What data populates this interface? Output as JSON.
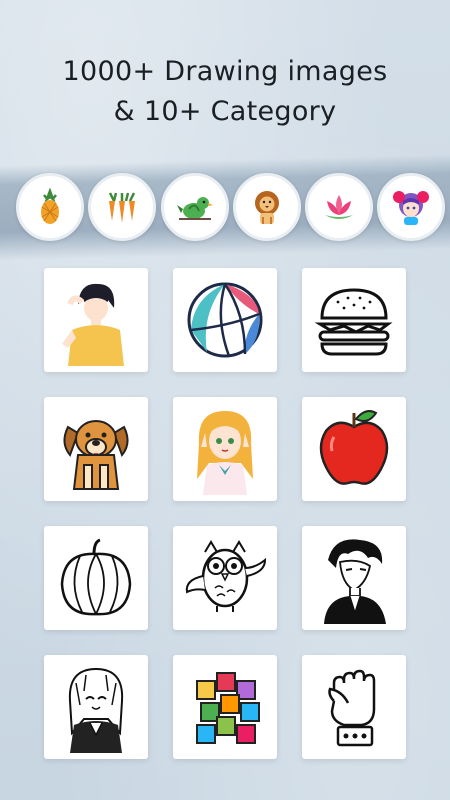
{
  "header": {
    "line1": "1000+ Drawing images",
    "line2": "& 10+ Category"
  },
  "categories": [
    {
      "icon": "pineapple-icon"
    },
    {
      "icon": "carrots-icon"
    },
    {
      "icon": "bird-icon"
    },
    {
      "icon": "lion-icon"
    },
    {
      "icon": "lotus-icon"
    },
    {
      "icon": "anime-girl-icon"
    }
  ],
  "drawings": [
    {
      "icon": "anime-boy-drawing"
    },
    {
      "icon": "beach-ball-drawing"
    },
    {
      "icon": "burger-drawing"
    },
    {
      "icon": "dog-drawing"
    },
    {
      "icon": "anime-girl-drawing"
    },
    {
      "icon": "apple-drawing"
    },
    {
      "icon": "pumpkin-drawing"
    },
    {
      "icon": "owl-drawing"
    },
    {
      "icon": "manga-man-drawing"
    },
    {
      "icon": "manga-girl-drawing"
    },
    {
      "icon": "cubes-drawing"
    },
    {
      "icon": "fist-drawing"
    }
  ],
  "colors": {
    "background": "#cfdbe5",
    "card": "#ffffff",
    "title": "#1a1f24"
  }
}
